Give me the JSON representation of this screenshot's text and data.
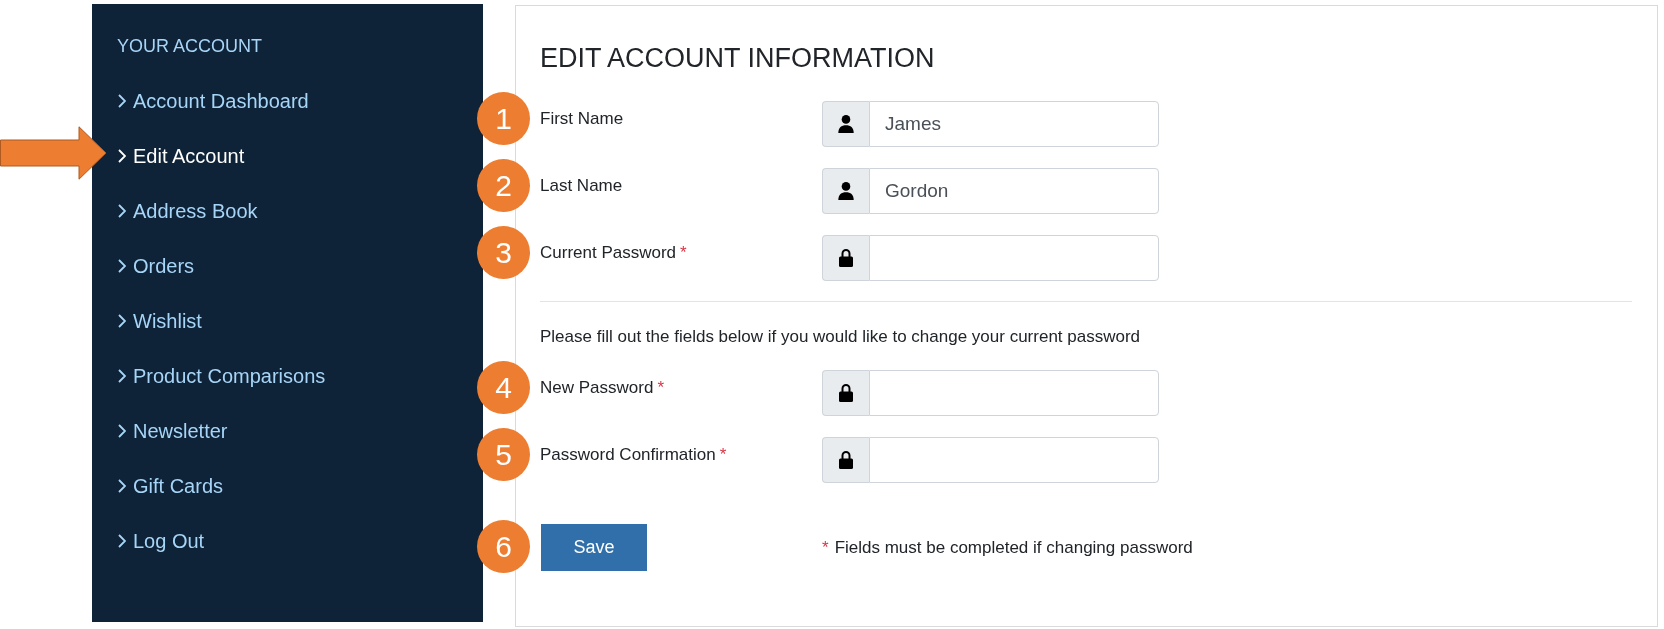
{
  "sidebar": {
    "heading": "YOUR ACCOUNT",
    "items": [
      {
        "label": "Account Dashboard",
        "selected": false,
        "arrow": false
      },
      {
        "label": "Edit Account",
        "selected": true,
        "arrow": true
      },
      {
        "label": "Address Book",
        "selected": false,
        "arrow": false
      },
      {
        "label": "Orders",
        "selected": false,
        "arrow": false
      },
      {
        "label": "Wishlist",
        "selected": false,
        "arrow": false
      },
      {
        "label": "Product Comparisons",
        "selected": false,
        "arrow": false
      },
      {
        "label": "Newsletter",
        "selected": false,
        "arrow": false
      },
      {
        "label": "Gift Cards",
        "selected": false,
        "arrow": false
      },
      {
        "label": "Log Out",
        "selected": false,
        "arrow": false
      }
    ]
  },
  "form": {
    "title": "EDIT ACCOUNT INFORMATION",
    "fields": [
      {
        "callout": "1",
        "label": "First Name",
        "kind": "name",
        "value": "James"
      },
      {
        "callout": "2",
        "label": "Last Name",
        "kind": "name",
        "value": "Gordon"
      },
      {
        "callout": "3",
        "label": "Current Password",
        "required_mark": "*",
        "kind": "password"
      }
    ],
    "password_hint": "Please fill out the fields below if you would like to change your current password",
    "password_fields": [
      {
        "callout": "4",
        "label": "New Password",
        "required_mark": "*",
        "kind": "password"
      },
      {
        "callout": "5",
        "label": "Password Confirmation",
        "required_mark": "*",
        "kind": "password"
      }
    ],
    "save_button": {
      "callout": "6",
      "label": "Save"
    },
    "note": {
      "mark": "*",
      "text": "Fields must be completed if changing password"
    }
  }
}
